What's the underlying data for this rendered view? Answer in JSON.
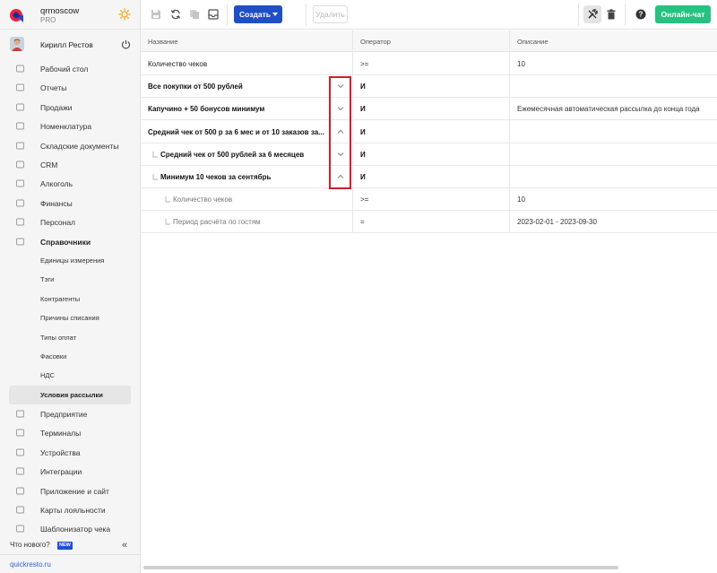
{
  "brand": {
    "name": "qrmoscow",
    "plan": "PRO"
  },
  "user": {
    "name": "Кирилл Рестов"
  },
  "nav": [
    {
      "label": "Рабочий стол",
      "icon": "dashboard-icon"
    },
    {
      "label": "Отчеты",
      "icon": "reports-icon"
    },
    {
      "label": "Продажи",
      "icon": "sales-icon"
    },
    {
      "label": "Номенклатура",
      "icon": "nomenclature-icon"
    },
    {
      "label": "Складские документы",
      "icon": "warehouse-icon"
    },
    {
      "label": "CRM",
      "icon": "crm-icon"
    },
    {
      "label": "Алкоголь",
      "icon": "alcohol-icon"
    },
    {
      "label": "Финансы",
      "icon": "finance-icon"
    },
    {
      "label": "Персонал",
      "icon": "staff-icon"
    },
    {
      "label": "Справочники",
      "icon": "directory-icon"
    }
  ],
  "subnav": [
    {
      "label": "Единицы измерения"
    },
    {
      "label": "Тэги"
    },
    {
      "label": "Контрагенты"
    },
    {
      "label": "Причины списания"
    },
    {
      "label": "Типы оплат"
    },
    {
      "label": "Фасовки"
    },
    {
      "label": "НДС"
    },
    {
      "label": "Условия рассылки"
    }
  ],
  "nav2": [
    {
      "label": "Предприятие",
      "icon": "enterprise-icon"
    },
    {
      "label": "Терминалы",
      "icon": "terminal-icon"
    },
    {
      "label": "Устройства",
      "icon": "printer-icon"
    },
    {
      "label": "Интеграции",
      "icon": "integrations-icon"
    },
    {
      "label": "Приложение и сайт",
      "icon": "app-icon"
    },
    {
      "label": "Карты лояльности",
      "icon": "loyalty-card-icon"
    },
    {
      "label": "Шаблонизатор чека",
      "icon": "receipt-template-icon"
    }
  ],
  "footer": {
    "whats_new": "Что нового?",
    "new_badge": "NEW",
    "collapse": "«",
    "site": "quickresto.ru"
  },
  "toolbar": {
    "create": "Создать",
    "delete": "Удалить",
    "chat": "Онлайн-чат"
  },
  "table": {
    "headers": {
      "name": "Название",
      "operator": "Оператор",
      "description": "Описание"
    },
    "rows": [
      {
        "name": "Количество чеков",
        "operator": ">=",
        "description": "10",
        "level": 0,
        "bold": false,
        "chevron": ""
      },
      {
        "name": "Все покупки от 500 рублей",
        "operator": "И",
        "description": "",
        "level": 0,
        "bold": true,
        "chevron": "down"
      },
      {
        "name": "Капучино + 50 бонусов минимум",
        "operator": "И",
        "description": "Ежемесячная автоматическая рассылка до конца года",
        "level": 0,
        "bold": true,
        "chevron": "down"
      },
      {
        "name": "Средний чек от 500 р за 6 мес и от 10 заказов за...",
        "operator": "И",
        "description": "",
        "level": 0,
        "bold": true,
        "chevron": "up"
      },
      {
        "name": "Средний чек от 500 рублей за 6 месяцев",
        "operator": "И",
        "description": "",
        "level": 1,
        "bold": true,
        "chevron": "down"
      },
      {
        "name": "Минимум 10 чеков за сентябрь",
        "operator": "И",
        "description": "",
        "level": 1,
        "bold": true,
        "chevron": "up"
      },
      {
        "name": "Количество чеков",
        "operator": ">=",
        "description": "10",
        "level": 2,
        "bold": false,
        "chevron": ""
      },
      {
        "name": "Период расчёта по гостям",
        "operator": "=",
        "description": "2023-02-01 - 2023-09-30",
        "level": 2,
        "bold": false,
        "chevron": ""
      }
    ]
  },
  "colors": {
    "primary": "#1f4fc5",
    "chat": "#26c281",
    "highlight": "#d0202a",
    "link": "#2b63d8"
  }
}
